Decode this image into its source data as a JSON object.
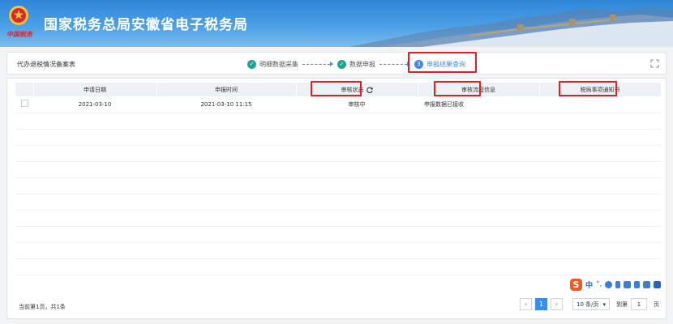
{
  "header": {
    "title": "国家税务总局安徽省电子税务局",
    "signature": "中国税务"
  },
  "topbar": {
    "form_name": "代办退税情况备案表",
    "steps": [
      {
        "number": "✓",
        "label": "明细数据采集"
      },
      {
        "number": "✓",
        "label": "数据申报"
      },
      {
        "number": "3",
        "label": "申报结果查询"
      }
    ]
  },
  "table": {
    "columns": [
      "",
      "申请日期",
      "申报时间",
      "审核状态",
      "审核流程信息",
      "税局事项通知书"
    ],
    "rows": [
      {
        "apply_date": "2021-03-10",
        "declare_time": "2021-03-10 11:15",
        "review_status": "审核中",
        "review_flow": "申报数据已接收",
        "notice": ""
      }
    ]
  },
  "footer": {
    "page_info": "当前第1页，共1条",
    "current_page": "1",
    "page_size": "10 条/页",
    "goto_label": "到第",
    "goto_value": "1",
    "page_unit": "页"
  },
  "ime": {
    "lang": "中",
    "punct": "°,"
  },
  "colors": {
    "accent": "#3a8ee6",
    "done": "#21a58d",
    "highlight": "#e02020"
  }
}
